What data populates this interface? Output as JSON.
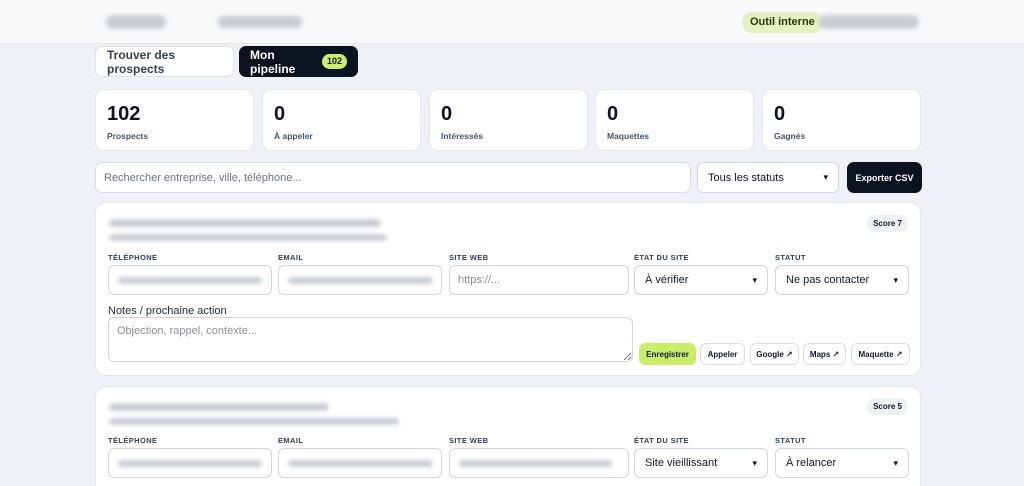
{
  "topbar": {
    "badge": "Outil interne"
  },
  "tabs": [
    {
      "label": "Trouver des prospects"
    },
    {
      "label": "Mon pipeline",
      "count": "102"
    }
  ],
  "stats": [
    {
      "value": "102",
      "label": "Prospects"
    },
    {
      "value": "0",
      "label": "À appeler"
    },
    {
      "value": "0",
      "label": "Intéressés"
    },
    {
      "value": "0",
      "label": "Maquettes"
    },
    {
      "value": "0",
      "label": "Gagnés"
    }
  ],
  "search": {
    "placeholder": "Rechercher entreprise, ville, téléphone...",
    "value": ""
  },
  "status_filter": {
    "selected": "Tous les statuts"
  },
  "export_label": "Exporter CSV",
  "field_labels": {
    "phone": "TÉLÉPHONE",
    "email": "EMAIL",
    "website": "SITE WEB",
    "site_state": "ÉTAT DU SITE",
    "status": "STATUT"
  },
  "notes_label": "Notes / prochaine action",
  "notes_placeholder": "Objection, rappel, contexte...",
  "website_placeholder": "https://...",
  "actions": {
    "save": "Enregistrer",
    "call": "Appeler",
    "google": "Google ↗",
    "maps": "Maps ↗",
    "mockup": "Maquette ↗"
  },
  "prospects": [
    {
      "score": "Score 7",
      "site_state": "À vérifier",
      "status": "Ne pas contacter"
    },
    {
      "score": "Score 5",
      "site_state": "Site vieillissant",
      "status": "À relancer"
    }
  ]
}
